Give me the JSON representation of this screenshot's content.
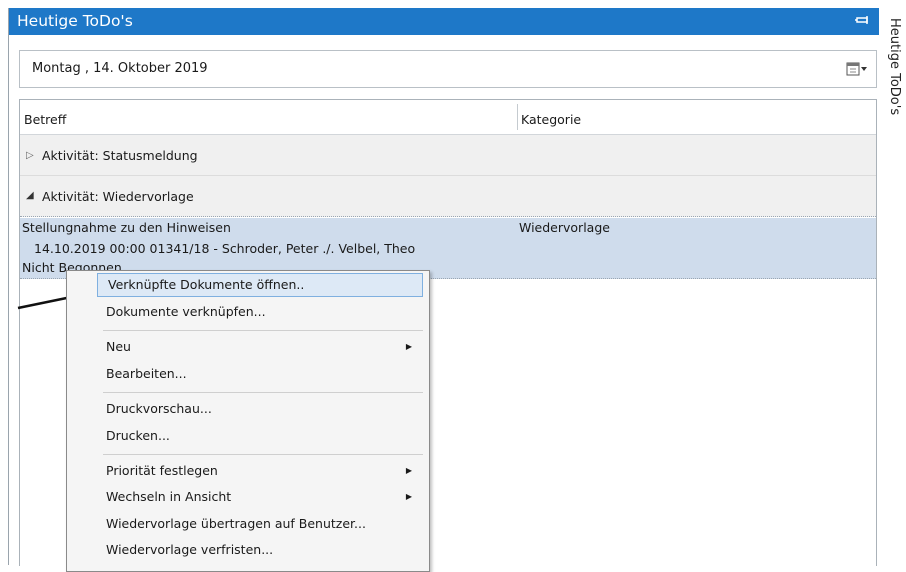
{
  "panel": {
    "title": "Heutige ToDo's"
  },
  "side_tab": {
    "label": "Heutige ToDo's"
  },
  "date_picker": {
    "value": "Montag   , 14.  Oktober  2019"
  },
  "columns": [
    "Betreff",
    "Kategorie"
  ],
  "groups": [
    {
      "label": "Aktivität: Statusmeldung",
      "expanded": false
    },
    {
      "label": "Aktivität: Wiedervorlage",
      "expanded": true
    }
  ],
  "task": {
    "subject": "Stellungnahme zu den Hinweisen",
    "category": "Wiedervorlage",
    "details": "14.10.2019 00:00 01341/18 - Schroder, Peter ./. Velbel, Theo",
    "status": "Nicht Begonnen"
  },
  "context_menu": {
    "items": [
      {
        "label": "Verknüpfte Dokumente öffnen..",
        "highlighted": true
      },
      {
        "label": "Dokumente verknüpfen..."
      },
      {
        "label": "Neu",
        "submenu": true
      },
      {
        "label": "Bearbeiten..."
      },
      {
        "label": "Druckvorschau..."
      },
      {
        "label": "Drucken..."
      },
      {
        "label": "Priorität festlegen",
        "submenu": true
      },
      {
        "label": "Wechseln in Ansicht",
        "submenu": true
      },
      {
        "label": "Wiedervorlage übertragen auf Benutzer..."
      },
      {
        "label": "Wiedervorlage verfristen..."
      }
    ]
  },
  "colors": {
    "titlebar": "#1e78c8",
    "selection": "#cfdcec",
    "menu_highlight": "#dde9f6"
  }
}
